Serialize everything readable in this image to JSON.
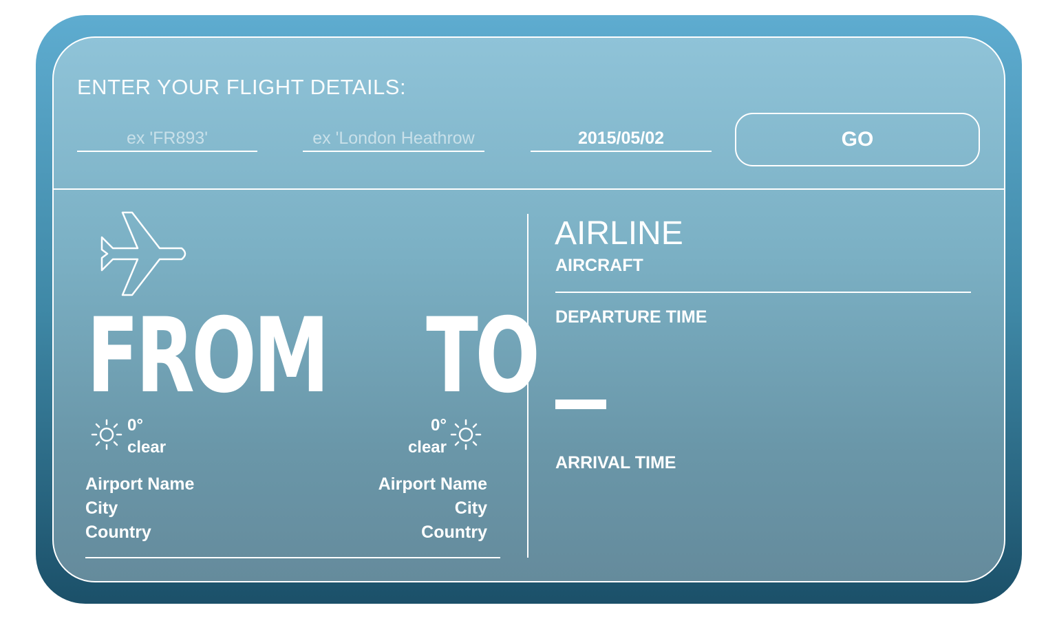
{
  "colors": {
    "outer_top": "#5eacd0",
    "outer_bottom": "#1b5069",
    "card_top": "#8fc3d8",
    "card_bottom": "#658b9c",
    "text": "#ffffff"
  },
  "form": {
    "prompt": "ENTER YOUR FLIGHT DETAILS:",
    "flight_number": {
      "placeholder": "ex 'FR893'",
      "value": ""
    },
    "airport": {
      "placeholder": "ex 'London Heathrow",
      "value": ""
    },
    "date": {
      "value": "2015/05/02"
    },
    "go_label": "GO"
  },
  "route": {
    "from_label": "FROM",
    "to_label": "TO",
    "origin": {
      "temperature": "0°",
      "condition": "clear",
      "weather_icon": "sun-icon",
      "airport_name": "Airport Name",
      "city": "City",
      "country": "Country"
    },
    "destination": {
      "temperature": "0°",
      "condition": "clear",
      "weather_icon": "sun-icon",
      "airport_name": "Airport Name",
      "city": "City",
      "country": "Country"
    },
    "plane_icon": "airplane-icon"
  },
  "flight_info": {
    "airline": "AIRLINE",
    "aircraft": "AIRCRAFT",
    "departure_label": "DEPARTURE TIME",
    "arrival_label": "ARRIVAL TIME"
  }
}
